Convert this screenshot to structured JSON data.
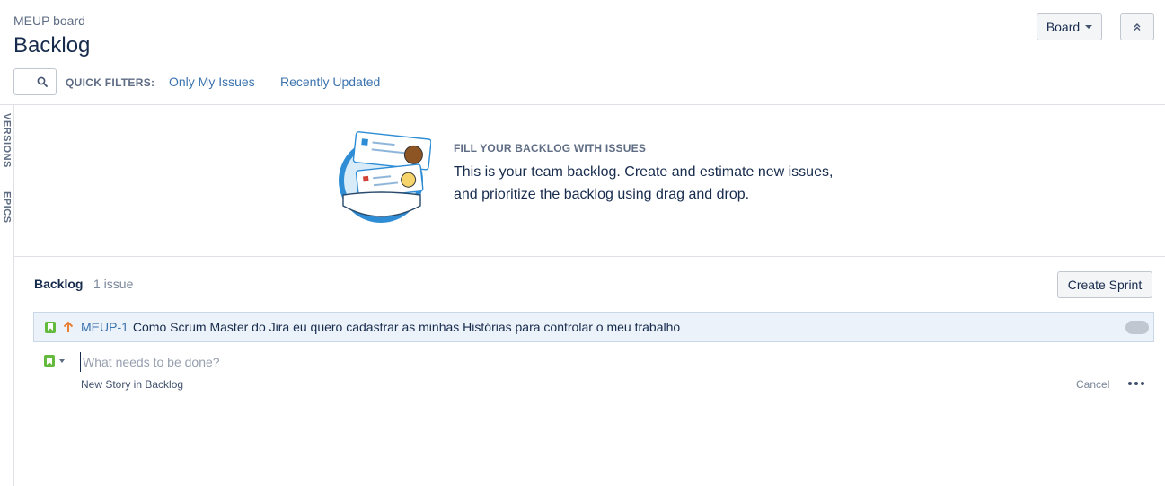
{
  "header": {
    "board_name": "MEUP board",
    "title": "Backlog",
    "board_button": "Board",
    "board_button_icon": "caret-down-icon",
    "collapse_icon": "double-chevron-up-icon"
  },
  "filters": {
    "search_icon": "search-icon",
    "label": "QUICK FILTERS:",
    "items": [
      "Only My Issues",
      "Recently Updated"
    ]
  },
  "side_tabs": [
    "VERSIONS",
    "EPICS"
  ],
  "empty_state": {
    "heading": "FILL YOUR BACKLOG WITH ISSUES",
    "line1": "This is your team backlog. Create and estimate new issues,",
    "line2": "and prioritize the backlog using drag and drop."
  },
  "backlog": {
    "title": "Backlog",
    "count": "1 issue",
    "create_sprint": "Create Sprint",
    "issues": [
      {
        "type_icon": "story-icon",
        "priority_icon": "priority-high-arrow-icon",
        "key": "MEUP-1",
        "summary": "Como Scrum Master do Jira eu quero cadastrar as minhas Histórias para controlar o meu trabalho"
      }
    ]
  },
  "new_issue": {
    "placeholder": "What needs to be done?",
    "hint": "New Story in Backlog",
    "cancel": "Cancel",
    "more_icon": "more-dots-icon"
  },
  "colors": {
    "link": "#3b73af",
    "story": "#63ba3c",
    "priority_high": "#e97f33",
    "selected_row": "#ebf2f9"
  }
}
